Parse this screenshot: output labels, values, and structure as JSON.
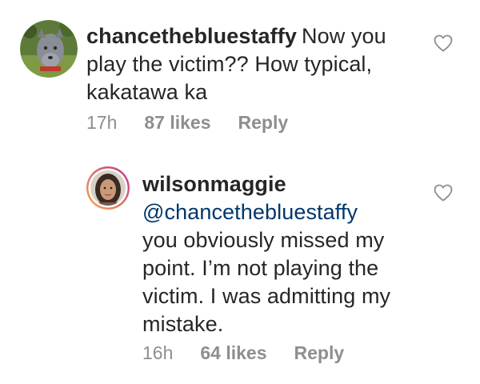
{
  "comments": [
    {
      "username": "chancethebluestaffy",
      "text": "Now you play the victim?? How typical, kakatawa ka",
      "time": "17h",
      "likes": "87 likes",
      "reply": "Reply"
    },
    {
      "username": "wilsonmaggie",
      "mention": "@chancethebluestaffy",
      "text": "you obviously missed my point. I’m not playing the victim. I was admitting my mistake.",
      "time": "16h",
      "likes": "64 likes",
      "reply": "Reply"
    }
  ],
  "colors": {
    "text": "#262626",
    "meta": "#8e8e8e",
    "mention": "#00376b",
    "story_ring_start": "#f9a94b",
    "story_ring_end": "#c1358a"
  },
  "icons": {
    "like": "heart-outline-icon"
  }
}
